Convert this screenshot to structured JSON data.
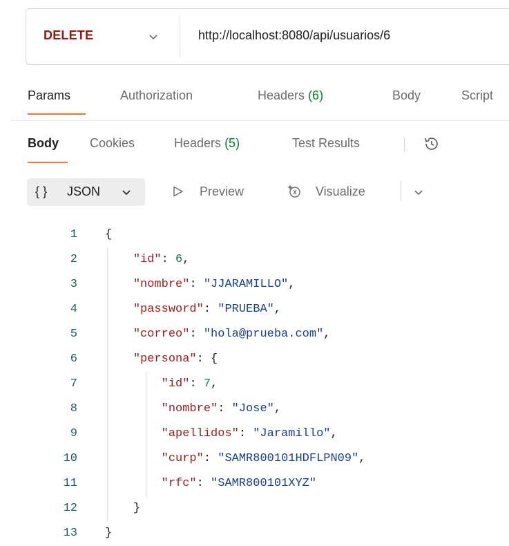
{
  "request": {
    "method": "DELETE",
    "url": "http://localhost:8080/api/usuarios/6"
  },
  "request_tabs": {
    "params": "Params",
    "authorization": "Authorization",
    "headers": "Headers",
    "headers_count": "(6)",
    "body": "Body",
    "scripts": "Script"
  },
  "response_tabs": {
    "body": "Body",
    "cookies": "Cookies",
    "headers": "Headers",
    "headers_count": "(5)",
    "test_results": "Test Results"
  },
  "format_toolbar": {
    "braces": "{ }",
    "format": "JSON",
    "preview": "Preview",
    "visualize": "Visualize"
  },
  "colors": {
    "method": "#8e1a10",
    "accent": "#ff6c37",
    "count_green": "#007f31"
  },
  "icons": [
    "chevron-down-icon",
    "history-icon",
    "play-outline-icon",
    "visualize-sparkle-icon"
  ],
  "editor": {
    "lines": [
      {
        "num": "1",
        "text": "{"
      },
      {
        "num": "2",
        "text": "    \"id\": 6,"
      },
      {
        "num": "3",
        "text": "    \"nombre\": \"JJARAMILLO\","
      },
      {
        "num": "4",
        "text": "    \"password\": \"PRUEBA\","
      },
      {
        "num": "5",
        "text": "    \"correo\": \"hola@prueba.com\","
      },
      {
        "num": "6",
        "text": "    \"persona\": {"
      },
      {
        "num": "7",
        "text": "        \"id\": 7,"
      },
      {
        "num": "8",
        "text": "        \"nombre\": \"Jose\","
      },
      {
        "num": "9",
        "text": "        \"apellidos\": \"Jaramillo\","
      },
      {
        "num": "10",
        "text": "        \"curp\": \"SAMR800101HDFLPN09\","
      },
      {
        "num": "11",
        "text": "        \"rfc\": \"SAMR800101XYZ\""
      },
      {
        "num": "12",
        "text": "    }"
      },
      {
        "num": "13",
        "text": "}"
      }
    ]
  }
}
